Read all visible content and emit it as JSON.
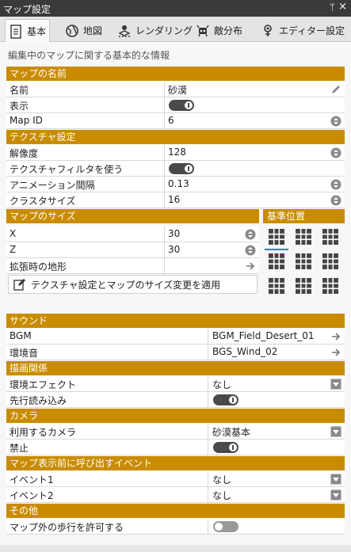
{
  "window": {
    "title": "マップ設定",
    "pin": "ᛘ",
    "close": "×"
  },
  "tabs": [
    {
      "label": "基本",
      "icon": "document-icon"
    },
    {
      "label": "地図",
      "icon": "globe-icon"
    },
    {
      "label": "レンダリング",
      "icon": "render-icon"
    },
    {
      "label": "敵分布",
      "icon": "enemy-icon"
    },
    {
      "label": "エディター設定",
      "icon": "editor-icon"
    }
  ],
  "subtitle": "編集中のマップに関する基本的な情報",
  "map_name": {
    "header": "マップの名前",
    "name_label": "名前",
    "name_value": "砂漠",
    "visible_label": "表示",
    "visible_on": true,
    "mapid_label": "Map ID",
    "mapid_value": "6"
  },
  "texture": {
    "header": "テクスチャ設定",
    "res_label": "解像度",
    "res_value": "128",
    "filter_label": "テクスチャフィルタを使う",
    "filter_on": true,
    "anim_label": "アニメーション間隔",
    "anim_value": "0.13",
    "cluster_label": "クラスタサイズ",
    "cluster_value": "16"
  },
  "map_size": {
    "header": "マップのサイズ",
    "x_label": "X",
    "x_value": "30",
    "z_label": "Z",
    "z_value": "30",
    "terrain_label": "拡張時の地形",
    "terrain_value": ""
  },
  "anchor": {
    "header": "基準位置",
    "selected": 0
  },
  "apply_label": "テクスチャ設定とマップのサイズ変更を適用",
  "sound": {
    "header": "サウンド",
    "bgm_label": "BGM",
    "bgm_value": "BGM_Field_Desert_01",
    "env_label": "環境音",
    "env_value": "BGS_Wind_02"
  },
  "draw": {
    "header": "描画関係",
    "effect_label": "環境エフェクト",
    "effect_value": "なし",
    "preload_label": "先行読み込み",
    "preload_on": true
  },
  "camera": {
    "header": "カメラ",
    "use_label": "利用するカメラ",
    "use_value": "砂漠基本",
    "forbid_label": "禁止",
    "forbid_on": true
  },
  "events": {
    "header": "マップ表示前に呼び出すイベント",
    "ev1_label": "イベント1",
    "ev1_value": "なし",
    "ev2_label": "イベント2",
    "ev2_value": "なし"
  },
  "other": {
    "header": "その他",
    "walk_label": "マップ外の歩行を許可する",
    "walk_on": false
  },
  "colors": {
    "section": "#c98c00",
    "titlebar": "#3a3a3a",
    "toggle_on": "#4a4a4a",
    "toggle_off": "#9a9a9a",
    "accent": "#2a7fd4"
  }
}
